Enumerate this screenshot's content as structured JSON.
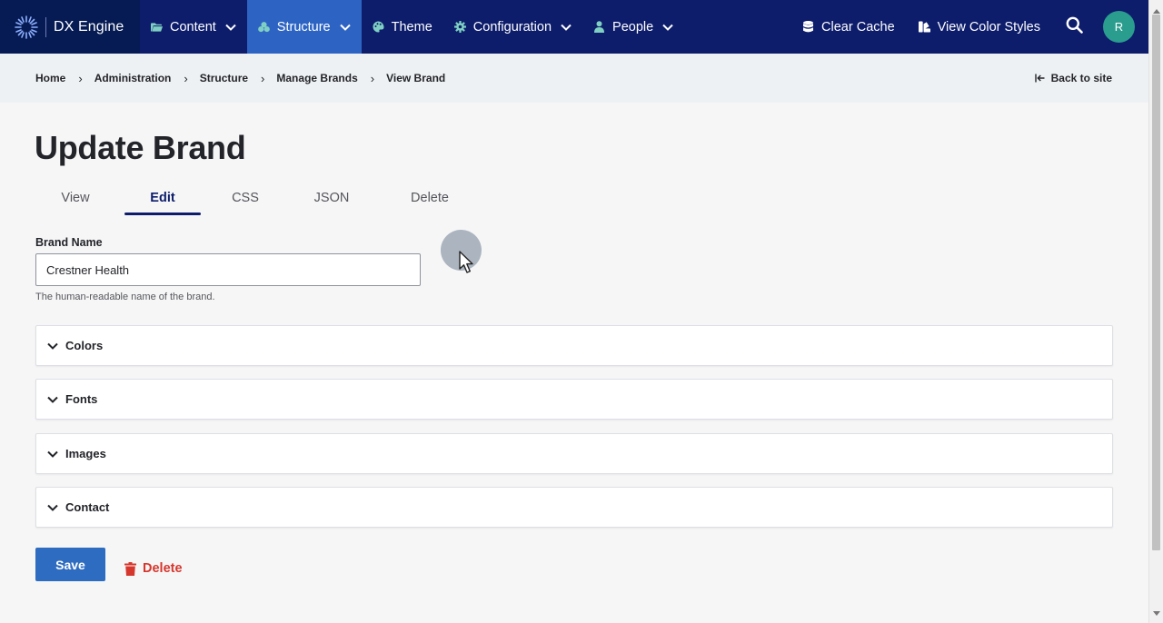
{
  "app": {
    "name": "DX Engine",
    "avatar_initial": "R"
  },
  "nav": {
    "items": [
      {
        "label": "Content",
        "icon": "folder-icon",
        "dropdown": true,
        "active": false
      },
      {
        "label": "Structure",
        "icon": "sitemap-icon",
        "dropdown": true,
        "active": true
      },
      {
        "label": "Theme",
        "icon": "palette-icon",
        "dropdown": false,
        "active": false
      },
      {
        "label": "Configuration",
        "icon": "gear-icon",
        "dropdown": true,
        "active": false
      },
      {
        "label": "People",
        "icon": "person-icon",
        "dropdown": true,
        "active": false
      }
    ],
    "right": {
      "clear_cache": "Clear Cache",
      "view_color_styles": "View Color Styles"
    }
  },
  "breadcrumb": {
    "items": [
      "Home",
      "Administration",
      "Structure",
      "Manage Brands",
      "View Brand"
    ],
    "back_label": "Back to site"
  },
  "page": {
    "title": "Update Brand",
    "tabs": [
      {
        "label": "View",
        "active": false
      },
      {
        "label": "Edit",
        "active": true
      },
      {
        "label": "CSS",
        "active": false
      },
      {
        "label": "JSON",
        "active": false
      },
      {
        "label": "Delete",
        "active": false
      }
    ]
  },
  "form": {
    "brand_name_label": "Brand Name",
    "brand_name_value": "Crestner Health",
    "brand_name_help": "The human-readable name of the brand.",
    "sections": [
      "Colors",
      "Fonts",
      "Images",
      "Contact"
    ],
    "save_label": "Save",
    "delete_label": "Delete"
  },
  "colors": {
    "topbar": "#0d1d6b",
    "brand_block": "#061b54",
    "active_nav": "#2d64c4",
    "save_button": "#2d6cc1",
    "delete_text": "#d6372d",
    "avatar": "#2a9d8f"
  }
}
